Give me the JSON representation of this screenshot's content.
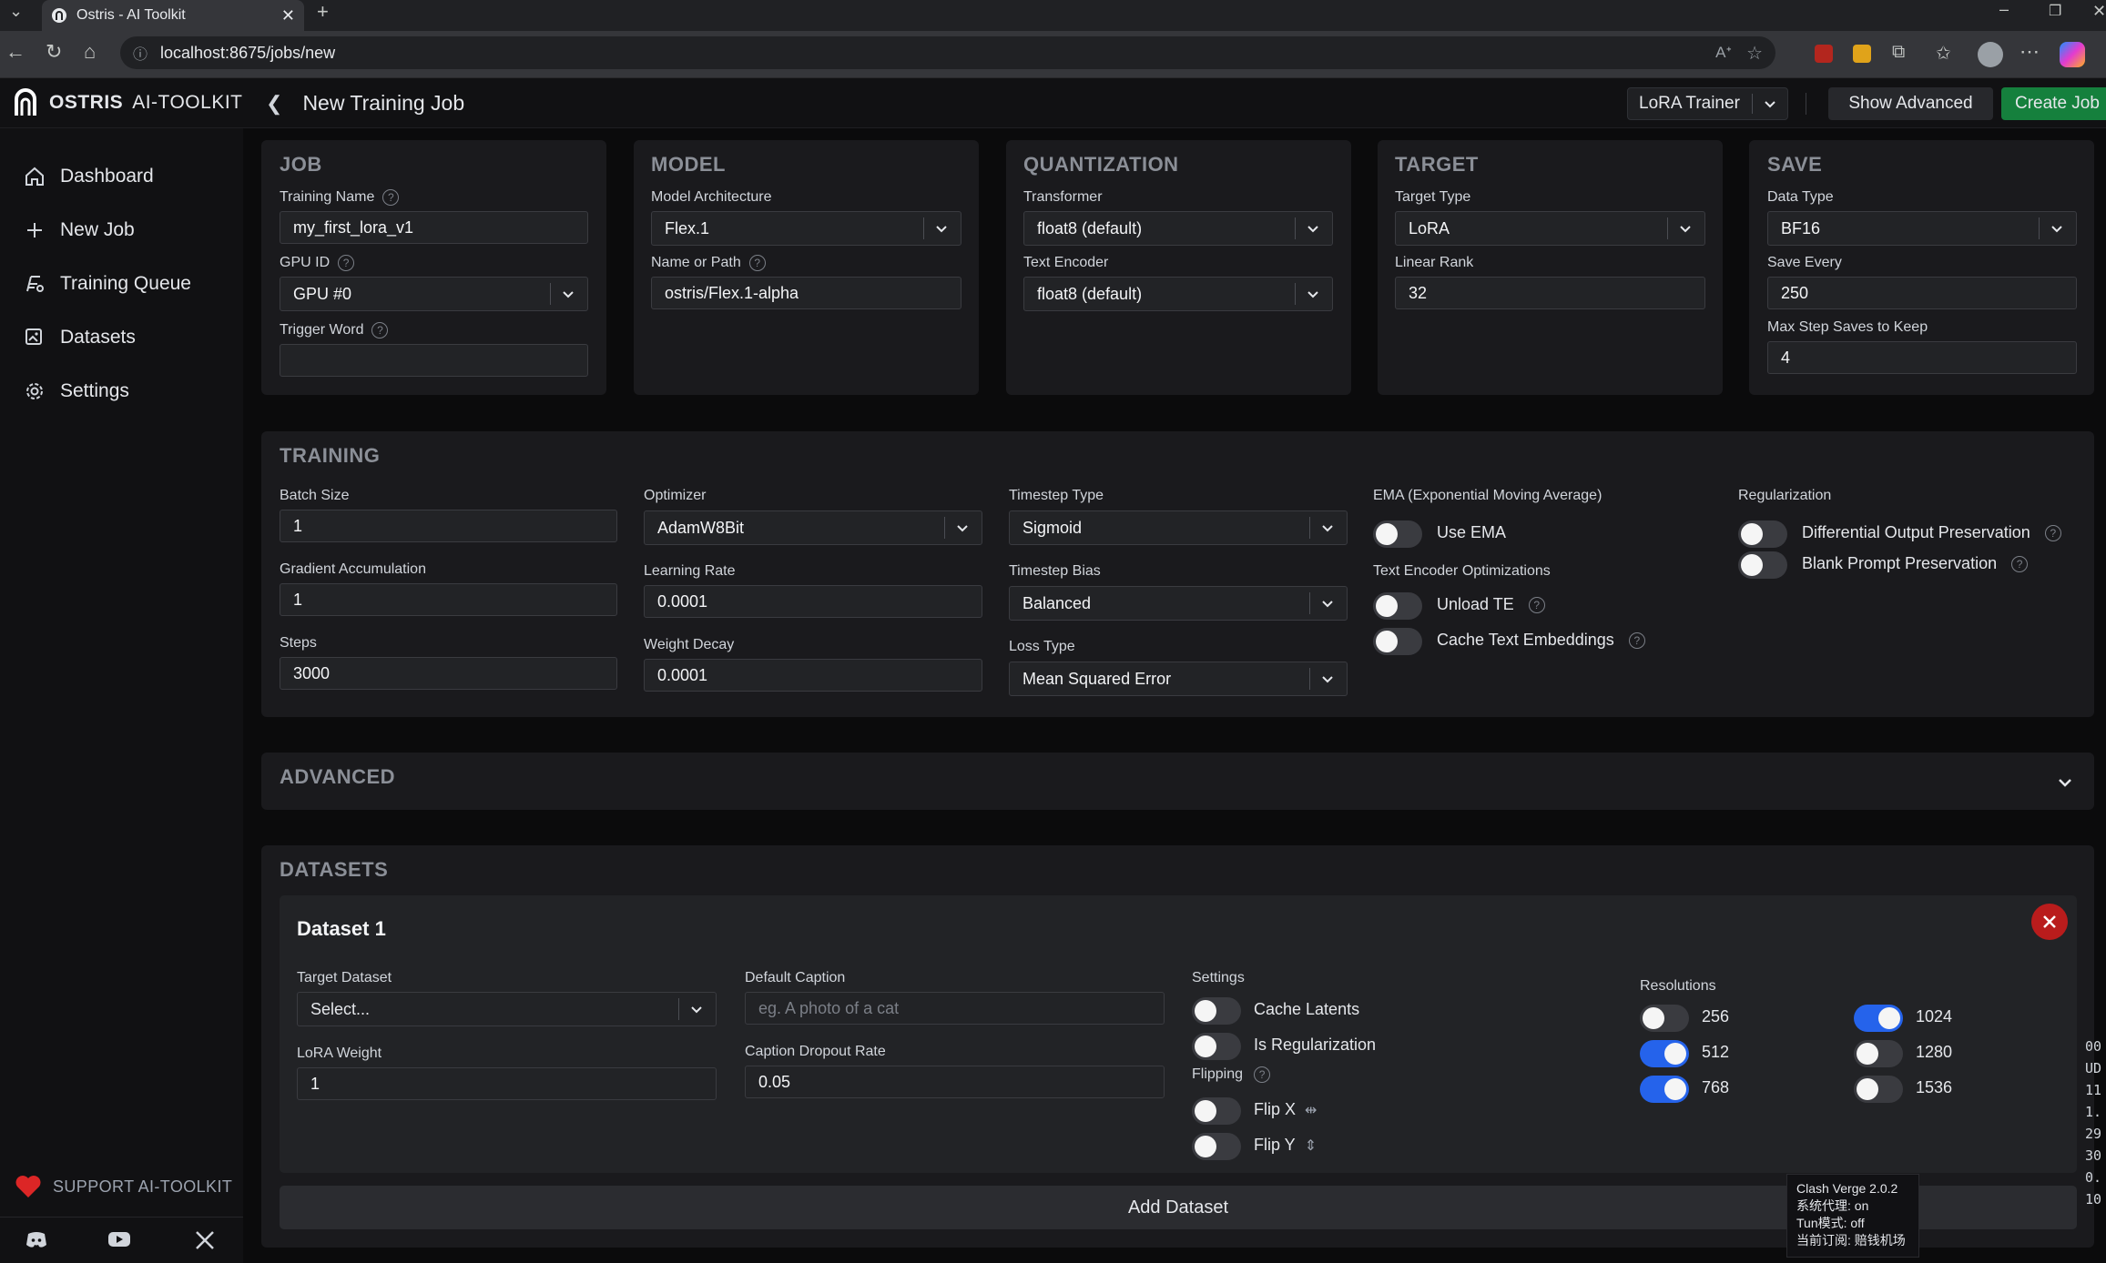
{
  "browser": {
    "tab_title": "Ostris - AI Toolkit",
    "url": "localhost:8675/jobs/new"
  },
  "header": {
    "brand_bold": "OSTRIS",
    "brand_light": "AI-TOOLKIT",
    "page_title": "New Training Job",
    "trainer_select": "LoRA Trainer",
    "show_advanced": "Show Advanced",
    "create_job": "Create Job"
  },
  "sidebar": {
    "items": [
      {
        "label": "Dashboard",
        "icon": "home-icon"
      },
      {
        "label": "New Job",
        "icon": "plus-icon"
      },
      {
        "label": "Training Queue",
        "icon": "queue-icon"
      },
      {
        "label": "Datasets",
        "icon": "images-icon"
      },
      {
        "label": "Settings",
        "icon": "gear-icon"
      }
    ],
    "support": "SUPPORT AI-TOOLKIT"
  },
  "job": {
    "title": "JOB",
    "training_name_label": "Training Name",
    "training_name": "my_first_lora_v1",
    "gpu_label": "GPU ID",
    "gpu": "GPU #0",
    "trigger_label": "Trigger Word",
    "trigger": ""
  },
  "model": {
    "title": "MODEL",
    "arch_label": "Model Architecture",
    "arch": "Flex.1",
    "path_label": "Name or Path",
    "path": "ostris/Flex.1-alpha"
  },
  "quantization": {
    "title": "QUANTIZATION",
    "transformer_label": "Transformer",
    "transformer": "float8 (default)",
    "te_label": "Text Encoder",
    "te": "float8 (default)"
  },
  "target": {
    "title": "TARGET",
    "type_label": "Target Type",
    "type": "LoRA",
    "rank_label": "Linear Rank",
    "rank": "32"
  },
  "save": {
    "title": "SAVE",
    "dtype_label": "Data Type",
    "dtype": "BF16",
    "every_label": "Save Every",
    "every": "250",
    "max_label": "Max Step Saves to Keep",
    "max": "4"
  },
  "training": {
    "title": "TRAINING",
    "batch_label": "Batch Size",
    "batch": "1",
    "grad_label": "Gradient Accumulation",
    "grad": "1",
    "steps_label": "Steps",
    "steps": "3000",
    "optimizer_label": "Optimizer",
    "optimizer": "AdamW8Bit",
    "lr_label": "Learning Rate",
    "lr": "0.0001",
    "wd_label": "Weight Decay",
    "wd": "0.0001",
    "ts_type_label": "Timestep Type",
    "ts_type": "Sigmoid",
    "ts_bias_label": "Timestep Bias",
    "ts_bias": "Balanced",
    "loss_label": "Loss Type",
    "loss": "Mean Squared Error",
    "ema_label": "EMA (Exponential Moving Average)",
    "use_ema": "Use EMA",
    "teo_label": "Text Encoder Optimizations",
    "unload_te": "Unload TE",
    "cache_te": "Cache Text Embeddings",
    "reg_label": "Regularization",
    "dop": "Differential Output Preservation",
    "bpp": "Blank Prompt Preservation"
  },
  "advanced": {
    "title": "ADVANCED"
  },
  "datasets": {
    "title": "DATASETS",
    "dataset_title": "Dataset 1",
    "target_label": "Target Dataset",
    "target_placeholder": "Select...",
    "weight_label": "LoRA Weight",
    "weight": "1",
    "caption_label": "Default Caption",
    "caption_placeholder": "eg. A photo of a cat",
    "dropout_label": "Caption Dropout Rate",
    "dropout": "0.05",
    "settings_label": "Settings",
    "cache_latents": "Cache Latents",
    "is_reg": "Is Regularization",
    "flipping_label": "Flipping",
    "flip_x": "Flip X",
    "flip_y": "Flip Y",
    "res_label": "Resolutions",
    "resolutions": [
      {
        "label": "256",
        "on": false
      },
      {
        "label": "512",
        "on": true
      },
      {
        "label": "768",
        "on": true
      },
      {
        "label": "1024",
        "on": true
      },
      {
        "label": "1280",
        "on": false
      },
      {
        "label": "1536",
        "on": false
      }
    ],
    "add_dataset": "Add Dataset"
  },
  "tooltip": {
    "line1": "Clash Verge 2.0.2",
    "line2": "系统代理: on",
    "line3": "Tun模式: off",
    "line4": "当前订阅: 赔钱机场"
  },
  "terminal_fragment": [
    "00",
    "UD",
    "11",
    "1.",
    "29",
    "30",
    "0.",
    "10"
  ],
  "colors": {
    "accent": "#2563eb",
    "create": "#15803d",
    "danger": "#b91c1c"
  }
}
